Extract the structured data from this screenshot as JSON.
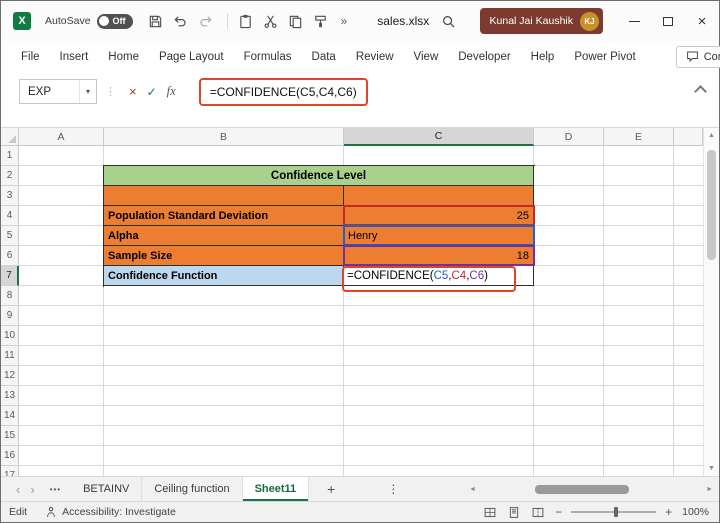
{
  "titlebar": {
    "autosave_label": "AutoSave",
    "autosave_state": "Off",
    "filename": "sales.xlsx",
    "user_name": "Kunal Jai Kaushik",
    "user_initials": "KJ"
  },
  "ribbon": {
    "tabs": [
      "File",
      "Insert",
      "Home",
      "Page Layout",
      "Formulas",
      "Data",
      "Review",
      "View",
      "Developer",
      "Help",
      "Power Pivot"
    ],
    "comments_label": "Comments"
  },
  "formula_bar": {
    "name_box_value": "EXP",
    "fx_label": "fx",
    "formula": "=CONFIDENCE(C5,C4,C6)"
  },
  "grid": {
    "column_headers": [
      "A",
      "B",
      "C",
      "D",
      "E"
    ],
    "row_headers": [
      "1",
      "2",
      "3",
      "4",
      "5",
      "6",
      "7",
      "8",
      "9",
      "10",
      "11",
      "12",
      "13",
      "14",
      "15",
      "16",
      "17"
    ],
    "selected_column": "C",
    "selected_row": "7",
    "table": {
      "title": "Confidence Level",
      "rows": [
        {
          "label": "Population Standard Deviation",
          "value": "25"
        },
        {
          "label": "Alpha",
          "value": "Henry"
        },
        {
          "label": "Sample Size",
          "value": "18"
        },
        {
          "label": "Confidence Function",
          "value": "=CONFIDENCE(C5,C4,C6)"
        }
      ],
      "formula_parts": [
        "=CONFIDENCE(",
        "C5",
        ",",
        "C4",
        ",",
        "C6",
        ")"
      ]
    },
    "colors": {
      "title_fill": "#A9D18E",
      "data_fill": "#ED7D31",
      "function_fill": "#BDD7EE",
      "ref_blue": "#2160C4",
      "ref_red": "#C02B2B",
      "ref_purple": "#7030A0",
      "annotation_red": "#E0452B",
      "accent_green": "#1E7145"
    }
  },
  "sheet_tabs": [
    "BETAINV",
    "Ceiling function",
    "Sheet11"
  ],
  "active_sheet": "Sheet11",
  "status_bar": {
    "mode": "Edit",
    "accessibility": "Accessibility: Investigate",
    "zoom": "100%"
  },
  "icons": {
    "excel_logo": "X",
    "overflow": "»",
    "chevron_down": "▾",
    "dots_vertical": "⋮",
    "dots_horizontal": "•••",
    "cancel": "×",
    "confirm": "✓",
    "close": "×",
    "add": "+",
    "nav_left": "‹",
    "nav_right": "›",
    "scroll_up": "▲",
    "scroll_down": "▼",
    "scroll_left": "◄",
    "scroll_right": "►",
    "minus": "−",
    "plus": "+"
  }
}
